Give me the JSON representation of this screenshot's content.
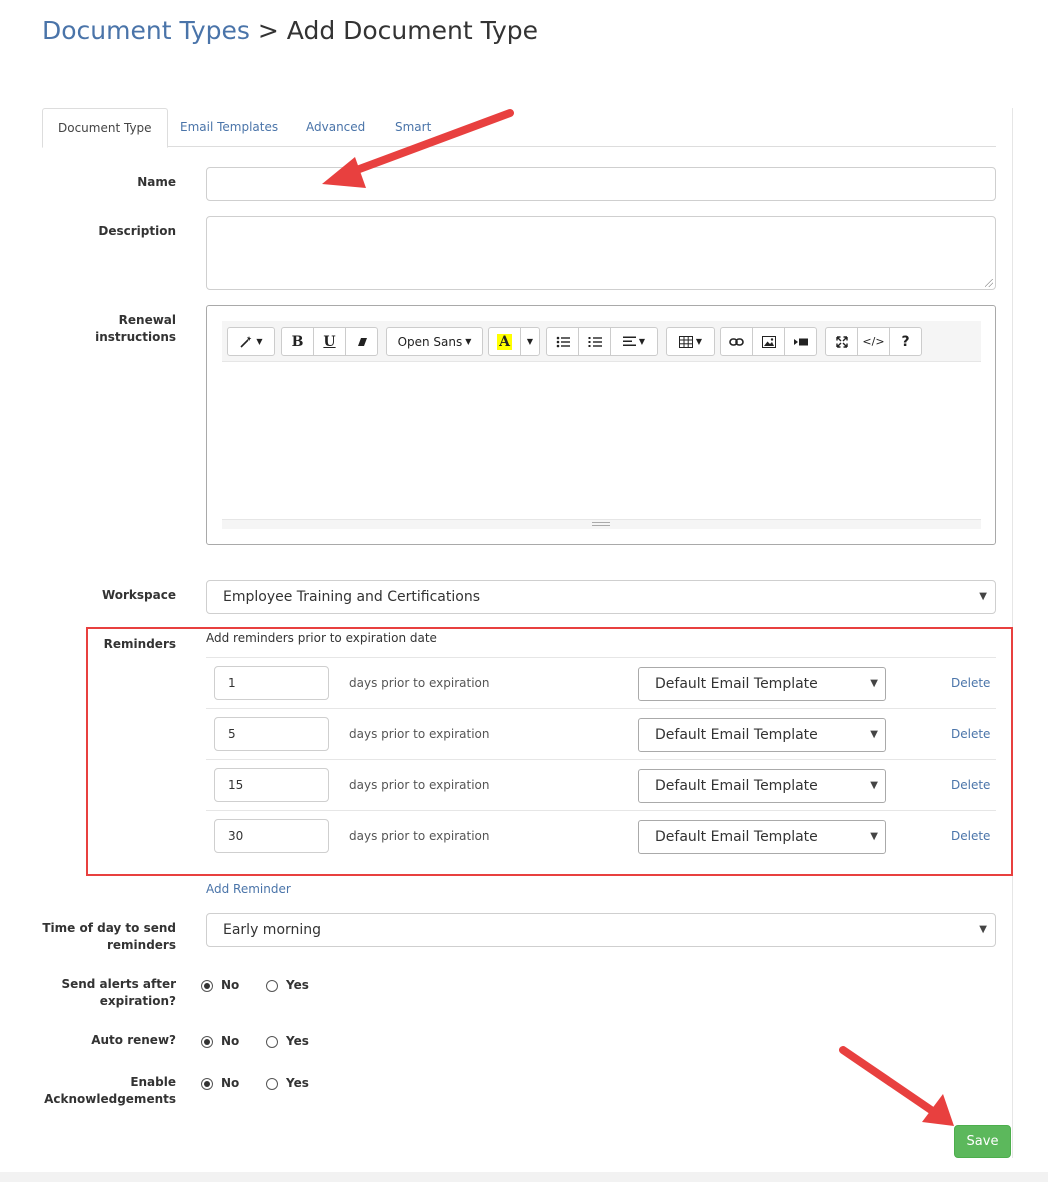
{
  "page": {
    "breadcrumb_link": "Document Types",
    "separator": ">",
    "current": "Add Document Type"
  },
  "tabs": [
    {
      "label": "Document Type",
      "active": true
    },
    {
      "label": "Email Templates",
      "active": false
    },
    {
      "label": "Advanced",
      "active": false
    },
    {
      "label": "Smart",
      "active": false
    }
  ],
  "form": {
    "name_label": "Name",
    "name_value": "",
    "description_label": "Description",
    "description_value": "",
    "renewal_label": "Renewal instructions",
    "editor": {
      "font_name": "Open Sans",
      "bold": "B",
      "underline": "U",
      "help": "?",
      "code": "</>",
      "highlight": "A"
    },
    "workspace_label": "Workspace",
    "workspace_value": "Employee Training and Certifications",
    "reminders_label": "Reminders",
    "reminders_header": "Add reminders prior to expiration date",
    "reminders": [
      {
        "days": "1",
        "text": "days prior to expiration",
        "template": "Default Email Template",
        "delete": "Delete"
      },
      {
        "days": "5",
        "text": "days prior to expiration",
        "template": "Default Email Template",
        "delete": "Delete"
      },
      {
        "days": "15",
        "text": "days prior to expiration",
        "template": "Default Email Template",
        "delete": "Delete"
      },
      {
        "days": "30",
        "text": "days prior to expiration",
        "template": "Default Email Template",
        "delete": "Delete"
      }
    ],
    "add_reminder": "Add Reminder",
    "time_label_1": "Time of day to send",
    "time_label_2": "reminders",
    "time_value": "Early morning",
    "alerts_label_1": "Send alerts after",
    "alerts_label_2": "expiration?",
    "autorenew_label": "Auto renew?",
    "ack_label_1": "Enable",
    "ack_label_2": "Acknowledgements",
    "no": "No",
    "yes": "Yes",
    "save": "Save"
  },
  "colors": {
    "link": "#4a74a9",
    "save": "#5cb85c",
    "highlight_box": "#e8403f",
    "annotation_arrow": "#e8403f"
  }
}
